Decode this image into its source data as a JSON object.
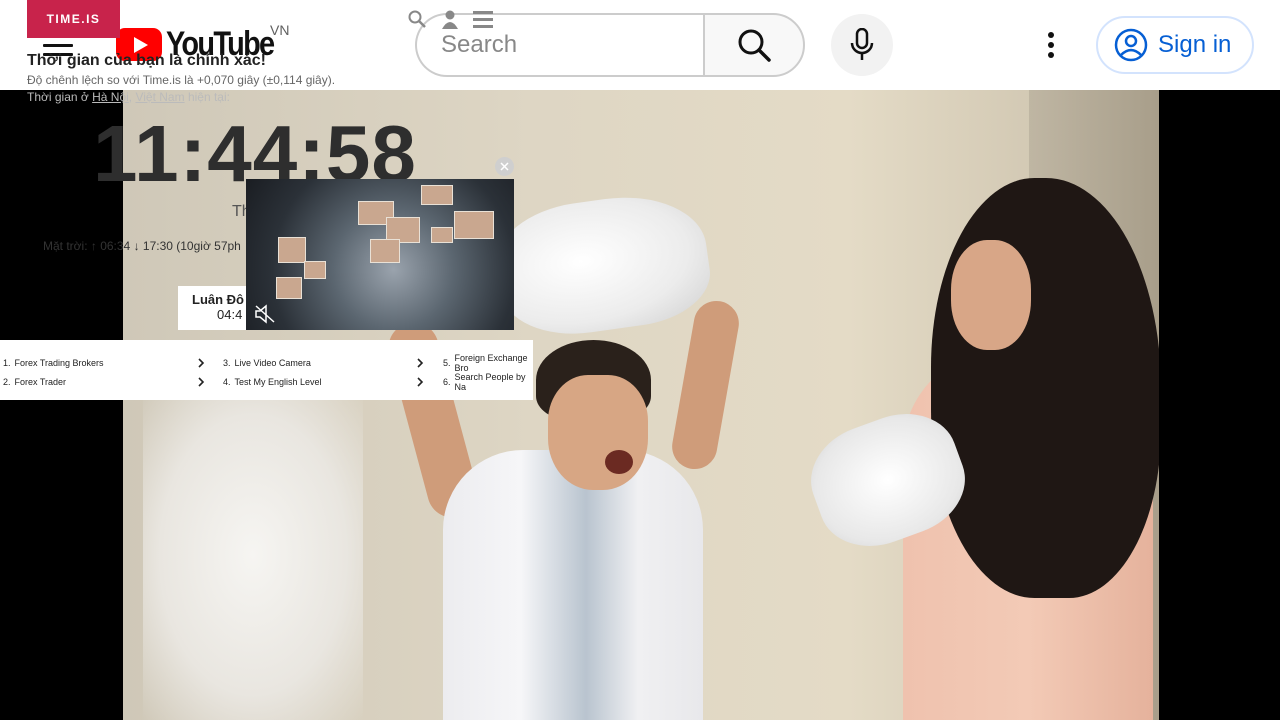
{
  "youtube": {
    "logo_text": "YouTube",
    "region": "VN",
    "search_placeholder": "Search",
    "signin_label": "Sign in"
  },
  "timeis": {
    "brand": "TIME.IS",
    "headline": "Thời gian của bạn là chính xác!",
    "difference": "Độ chênh lệch so với Time.is là +0,070 giây (±0,114 giây).",
    "location_prefix": "Thời gian ở ",
    "location_city": "Hà Nội",
    "location_sep": ", ",
    "location_country": "Việt Nam",
    "location_suffix": " hiện tại:",
    "clock": "11:44:58",
    "date_partial": "Th",
    "sun": "Mặt trời: ↑ 06:34 ↓ 17:30 (10giờ 57ph",
    "city_card": {
      "name": "Luân Đô",
      "time": "04:4"
    }
  },
  "ad_links": {
    "col1": [
      {
        "num": "1.",
        "label": "Forex Trading Brokers"
      },
      {
        "num": "2.",
        "label": "Forex Trader"
      }
    ],
    "col2": [
      {
        "num": "3.",
        "label": "Live Video Camera"
      },
      {
        "num": "4.",
        "label": "Test My English Level"
      }
    ],
    "col3": [
      {
        "num": "5.",
        "label": "Foreign Exchange Bro"
      },
      {
        "num": "6.",
        "label": "Search People by Na"
      }
    ]
  },
  "colors": {
    "timeis_brand": "#c8234b",
    "youtube_red": "#ff0000",
    "signin_blue": "#065fd4"
  },
  "icons": [
    "menu-icon",
    "search-icon",
    "mic-icon",
    "more-vert-icon",
    "account-icon",
    "mute-icon",
    "close-icon",
    "chevron-right-icon",
    "magnifier-icon",
    "user-icon"
  ]
}
